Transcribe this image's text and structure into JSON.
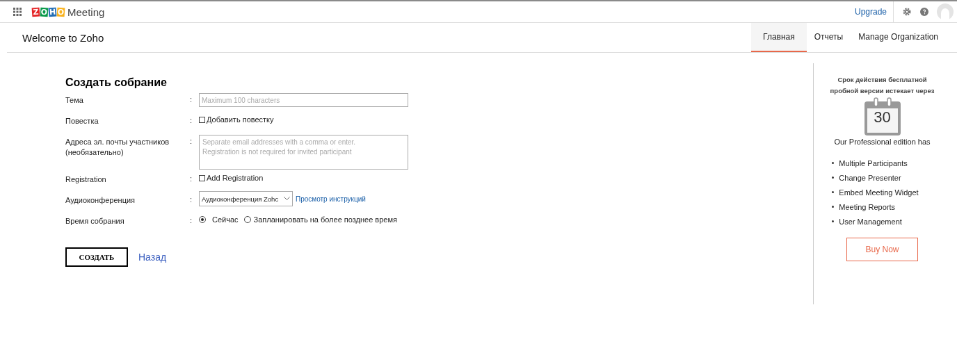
{
  "topbar": {
    "logo_letters": [
      {
        "char": "Z",
        "color": "#e42527"
      },
      {
        "char": "O",
        "color": "#089949"
      },
      {
        "char": "H",
        "color": "#226db4"
      },
      {
        "char": "O",
        "color": "#f9b21d"
      }
    ],
    "app_name": "Meeting",
    "upgrade": "Upgrade"
  },
  "header": {
    "title": "Welcome to Zoho",
    "tabs": [
      {
        "label": "Главная",
        "selected": true
      },
      {
        "label": "Отчеты",
        "selected": false
      },
      {
        "label": "Manage Organization",
        "selected": false
      }
    ]
  },
  "form": {
    "title": "Создать собрание",
    "rows": [
      {
        "kind": "text",
        "label": "Тема",
        "colon": ":",
        "placeholder": "Maximum 100 characters"
      },
      {
        "kind": "checkbox",
        "label": "Повестка",
        "colon": ":",
        "option": "Добавить повестку",
        "checked": false
      },
      {
        "kind": "textarea",
        "label": "Адреса эл. почты участников (необязательно)",
        "colon": ":",
        "placeholder": "Separate email addresses with a comma or enter.\nRegistration is not required for invited participant"
      },
      {
        "kind": "checkbox",
        "label": "Registration",
        "colon": ":",
        "option": "Add Registration",
        "checked": false
      },
      {
        "kind": "select",
        "label": "Аудиоконференция",
        "colon": ":",
        "value": "Аудиоконференция Zohc",
        "link": "Просмотр инструкций"
      },
      {
        "kind": "radio",
        "label": "Время собрания",
        "colon": ":",
        "options": [
          {
            "label": "Сейчас",
            "selected": true
          },
          {
            "label": "Запланировать на более позднее время",
            "selected": false
          }
        ]
      }
    ],
    "submit": "СОЗДАТЬ",
    "back": "Назад"
  },
  "promo": {
    "heading": "Срок действия бесплатной пробной версии истекает через",
    "days": "30",
    "subtitle": "Our Professional edition has",
    "features": [
      "Multiple Participants",
      "Change Presenter",
      "Embed Meeting Widget",
      "Meeting Reports",
      "User Management"
    ],
    "button": "Buy Now"
  }
}
